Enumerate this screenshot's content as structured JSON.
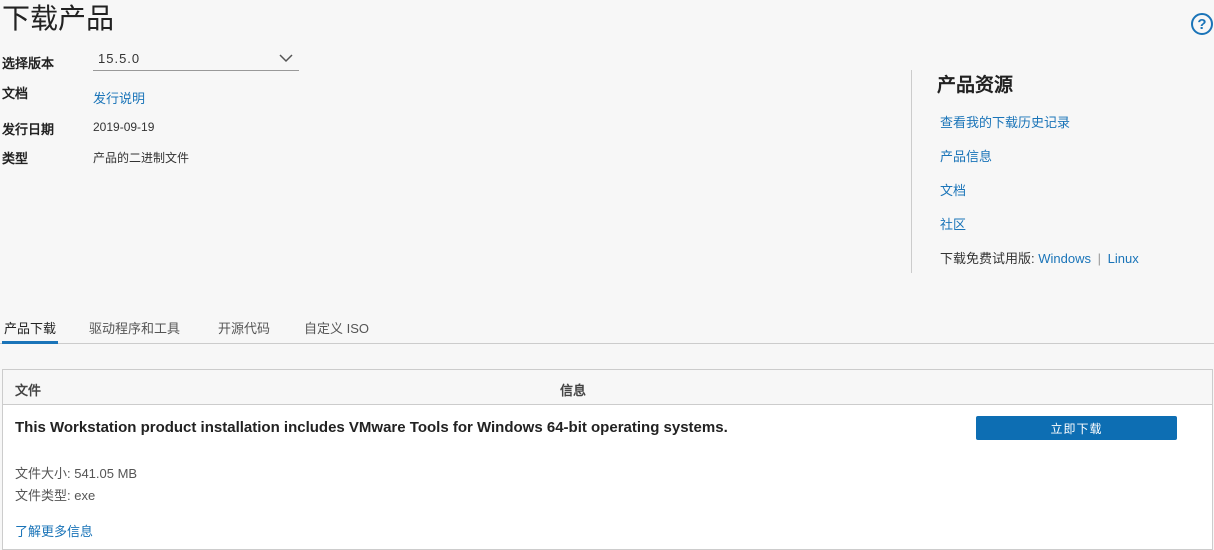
{
  "page": {
    "title": "下载产品",
    "help_icon": "question-circle-icon"
  },
  "details": {
    "version_label": "选择版本",
    "version_value": "15.5.0",
    "docs_label": "文档",
    "docs_link": "发行说明",
    "release_date_label": "发行日期",
    "release_date_value": "2019-09-19",
    "type_label": "类型",
    "type_value": "产品的二进制文件"
  },
  "resources": {
    "title": "产品资源",
    "links": [
      "查看我的下载历史记录",
      "产品信息",
      "文档",
      "社区"
    ],
    "trial_label": "下载免费试用版:",
    "trial_windows": "Windows",
    "trial_sep": "|",
    "trial_linux": "Linux"
  },
  "tabs": [
    {
      "label": "产品下载",
      "active": true
    },
    {
      "label": "驱动程序和工具",
      "active": false
    },
    {
      "label": "开源代码",
      "active": false
    },
    {
      "label": "自定义 ISO",
      "active": false
    }
  ],
  "table": {
    "col_file": "文件",
    "col_info": "信息",
    "row": {
      "description": "This Workstation product installation includes VMware Tools for Windows 64-bit operating systems.",
      "size": "文件大小: 541.05 MB",
      "filetype": "文件类型: exe",
      "more": "了解更多信息",
      "download_button": "立即下载"
    }
  },
  "colors": {
    "accent": "#1a74b8",
    "button": "#0d6eb3",
    "background": "#f7f7f7"
  }
}
